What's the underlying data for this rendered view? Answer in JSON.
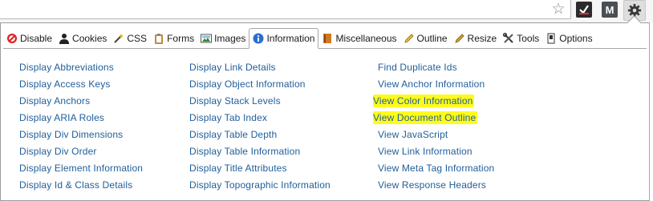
{
  "tabs": [
    {
      "id": "disable",
      "label": "Disable",
      "icon": "disable-icon"
    },
    {
      "id": "cookies",
      "label": "Cookies",
      "icon": "cookies-icon"
    },
    {
      "id": "css",
      "label": "CSS",
      "icon": "css-wand-icon"
    },
    {
      "id": "forms",
      "label": "Forms",
      "icon": "forms-clipboard-icon"
    },
    {
      "id": "images",
      "label": "Images",
      "icon": "images-picture-icon"
    },
    {
      "id": "information",
      "label": "Information",
      "icon": "information-icon",
      "active": true
    },
    {
      "id": "miscellaneous",
      "label": "Miscellaneous",
      "icon": "miscellaneous-book-icon"
    },
    {
      "id": "outline",
      "label": "Outline",
      "icon": "outline-pencil-icon"
    },
    {
      "id": "resize",
      "label": "Resize",
      "icon": "resize-pencil-icon"
    },
    {
      "id": "tools",
      "label": "Tools",
      "icon": "tools-wrench-icon"
    },
    {
      "id": "options",
      "label": "Options",
      "icon": "options-switch-icon"
    }
  ],
  "columns": [
    {
      "items": [
        "Display Abbreviations",
        "Display Access Keys",
        "Display Anchors",
        "Display ARIA Roles",
        "Display Div Dimensions",
        "Display Div Order",
        "Display Element Information",
        "Display Id & Class Details"
      ]
    },
    {
      "items": [
        "Display Link Details",
        "Display Object Information",
        "Display Stack Levels",
        "Display Tab Index",
        "Display Table Depth",
        "Display Table Information",
        "Display Title Attributes",
        "Display Topographic Information"
      ]
    },
    {
      "items": [
        "Find Duplicate Ids",
        "View Anchor Information",
        "View Color Information",
        "View Document Outline",
        "View JavaScript",
        "View Link Information",
        "View Meta Tag Information",
        "View Response Headers"
      ],
      "highlighted": [
        "View Color Information",
        "View Document Outline"
      ]
    }
  ],
  "toolbar": {
    "star_icon": "bookmark-star-icon",
    "extension1_icon": "checkmark-extension-icon",
    "extension2_label": "M",
    "gear_icon": "gear-icon"
  },
  "colors": {
    "link": "#1f5e9a",
    "highlight": "#fffb1a",
    "border": "#a7a7a7"
  }
}
